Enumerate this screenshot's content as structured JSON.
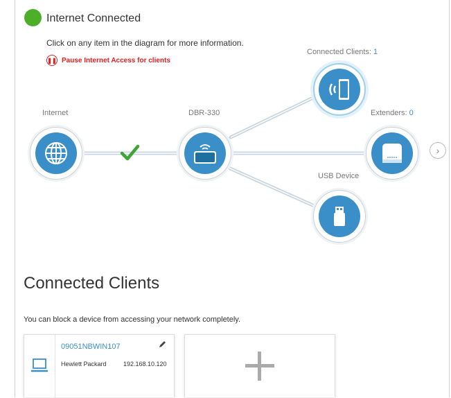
{
  "status": {
    "text": "Internet Connected",
    "color": "#4caf28"
  },
  "instruction": "Click on any item in the diagram for more information.",
  "pause_link": {
    "label": "Pause Internet Access for clients",
    "icon": "pause-icon",
    "color": "#e02020"
  },
  "diagram": {
    "internet": {
      "label": "Internet",
      "icon": "globe-icon"
    },
    "router": {
      "label": "DBR-330",
      "icon": "router-icon"
    },
    "connected_clients": {
      "label": "Connected Clients:",
      "count": "1",
      "icon": "wireless-device-icon"
    },
    "extenders": {
      "label": "Extenders:",
      "count": "0",
      "icon": "extender-icon"
    },
    "usb_device": {
      "label": "USB Device",
      "icon": "usb-icon"
    },
    "link_status_icon": "checkmark-icon",
    "accent_color": "#3a8fc8"
  },
  "section": {
    "title": "Connected Clients",
    "description": "You can block a device from accessing your network completely."
  },
  "clients": [
    {
      "name": "09051NBWIN107",
      "vendor": "Hewlett Packard",
      "ip": "192.168.10.120",
      "icon": "laptop-icon"
    }
  ],
  "add_client_icon": "plus-icon"
}
